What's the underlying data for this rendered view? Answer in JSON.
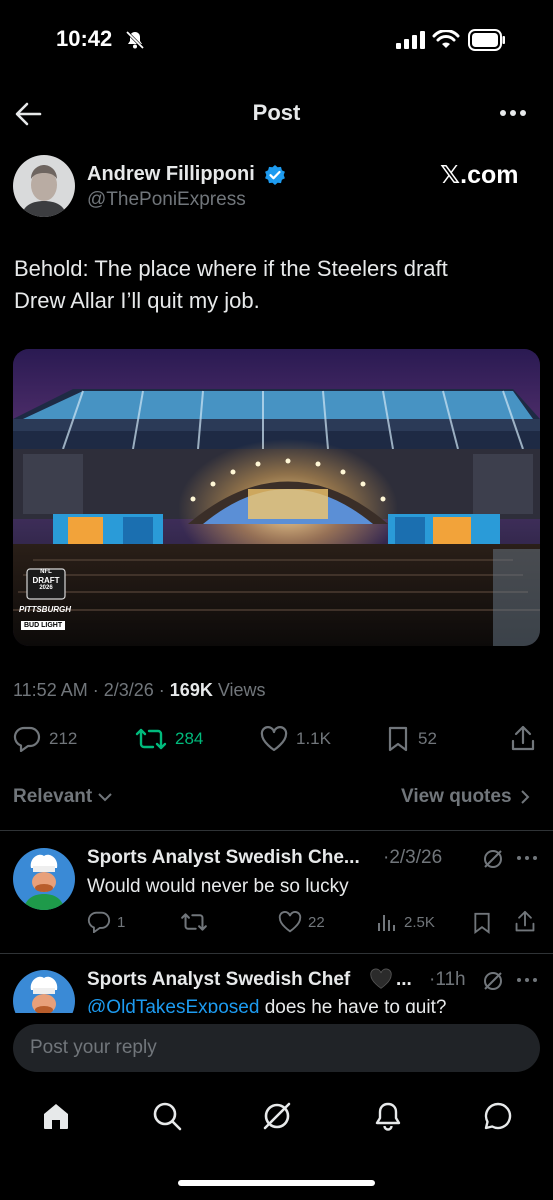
{
  "status": {
    "time": "10:42"
  },
  "header": {
    "title": "Post"
  },
  "author": {
    "name": "Andrew Fillipponi",
    "handle": "@ThePoniExpress",
    "brand": "𝕏.com"
  },
  "tweet": {
    "text_line1": "Behold: The place where if the Steelers draft",
    "text_line2": "Drew Allar I’ll quit my job.",
    "media_logo": {
      "line1": "NFL",
      "line2": "DRAFT",
      "line3": "2026",
      "city": "PITTSBURGH",
      "sponsor": "BUD LIGHT"
    },
    "time": "11:52 AM",
    "date": "2/3/26",
    "views_count": "169K",
    "views_label": "Views",
    "replies": "212",
    "reposts": "284",
    "likes": "1.1K",
    "bookmarks": "52"
  },
  "filters": {
    "sort": "Relevant",
    "view_quotes": "View quotes"
  },
  "replies": [
    {
      "name": "Sports Analyst Swedish Che...",
      "time": "2/3/26",
      "text": "Would would never be so lucky",
      "replies": "1",
      "likes": "22",
      "views": "2.5K"
    },
    {
      "name": "Sports Analyst Swedish Chef",
      "name_suffix": "...",
      "time": "11h",
      "mention": "@OldTakesExposed",
      "text": " does he have to quit?"
    }
  ],
  "compose": {
    "placeholder": "Post your reply"
  },
  "colors": {
    "accent": "#1d9bf0",
    "repost": "#00ba7c",
    "muted": "#71767b"
  },
  "icons": [
    "back-arrow-icon",
    "more-icon",
    "verified-icon",
    "reply-icon",
    "repost-icon",
    "like-icon",
    "bookmark-icon",
    "share-icon",
    "views-icon",
    "grok-icon",
    "home-icon",
    "search-icon",
    "notifications-icon",
    "messages-icon"
  ]
}
